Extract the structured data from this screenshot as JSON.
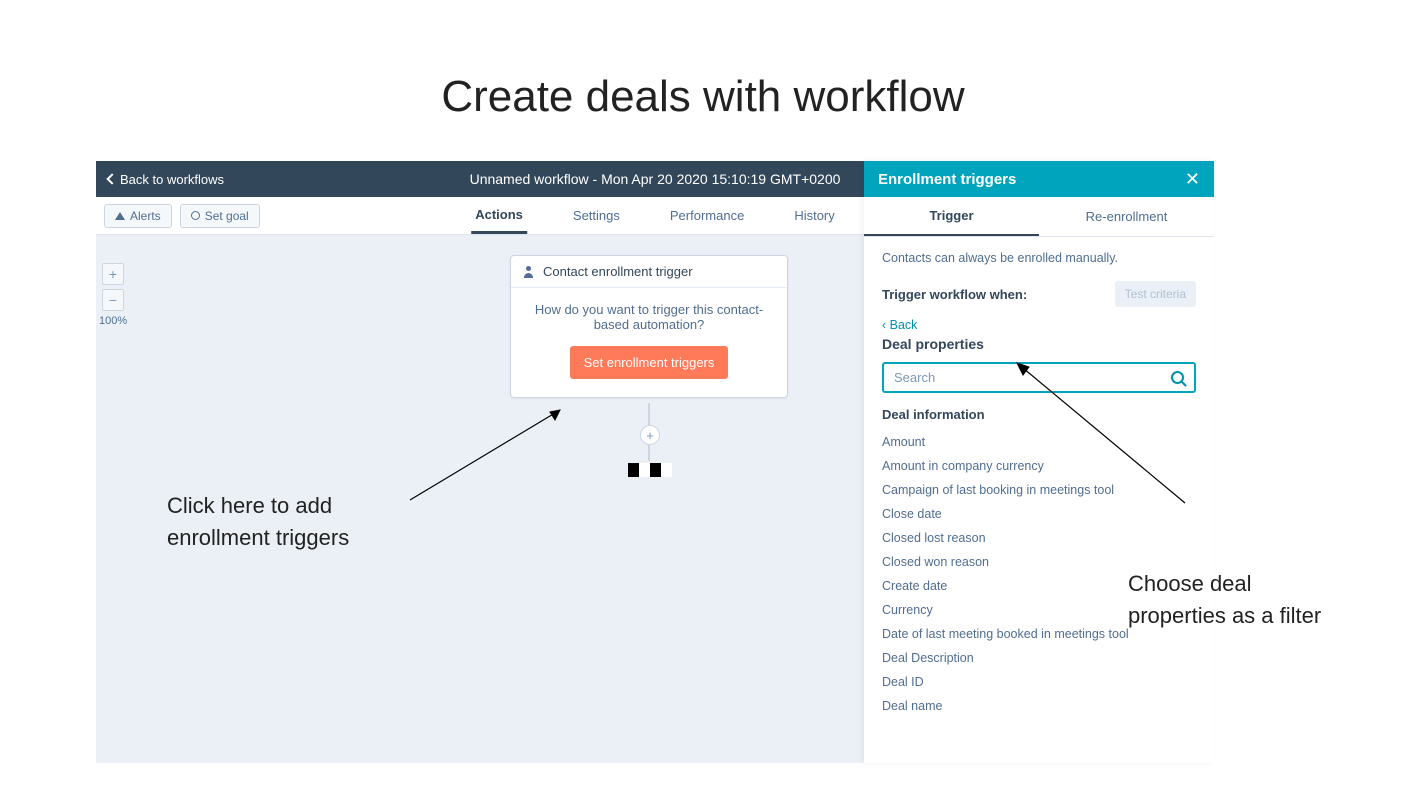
{
  "slide": {
    "title": "Create deals with workflow",
    "annotation1": "Click here to add enrollment triggers",
    "annotation2": "Choose deal properties as a filter"
  },
  "topbar": {
    "back_label": "Back to workflows",
    "workflow_name": "Unnamed workflow - Mon Apr 20 2020 15:10:19 GMT+0200"
  },
  "secbar": {
    "alerts_label": "Alerts",
    "set_goal_label": "Set goal",
    "tabs": [
      "Actions",
      "Settings",
      "Performance",
      "History"
    ],
    "active_tab": "Actions"
  },
  "canvas": {
    "zoom_in": "+",
    "zoom_out": "−",
    "zoom_pct": "100%",
    "card_title": "Contact enrollment trigger",
    "card_question": "How do you want to trigger this contact-based automation?",
    "card_button": "Set enrollment triggers",
    "add_step": "+"
  },
  "panel": {
    "title": "Enrollment triggers",
    "tabs": [
      "Trigger",
      "Re-enrollment"
    ],
    "active_tab": "Trigger",
    "hint": "Contacts can always be enrolled manually.",
    "trigger_when": "Trigger workflow when:",
    "test_criteria": "Test criteria",
    "back": "‹  Back",
    "section": "Deal properties",
    "search_placeholder": "Search",
    "group": "Deal information",
    "props": [
      "Amount",
      "Amount in company currency",
      "Campaign of last booking in meetings tool",
      "Close date",
      "Closed lost reason",
      "Closed won reason",
      "Create date",
      "Currency",
      "Date of last meeting booked in meetings tool",
      "Deal Description",
      "Deal ID",
      "Deal name"
    ]
  }
}
